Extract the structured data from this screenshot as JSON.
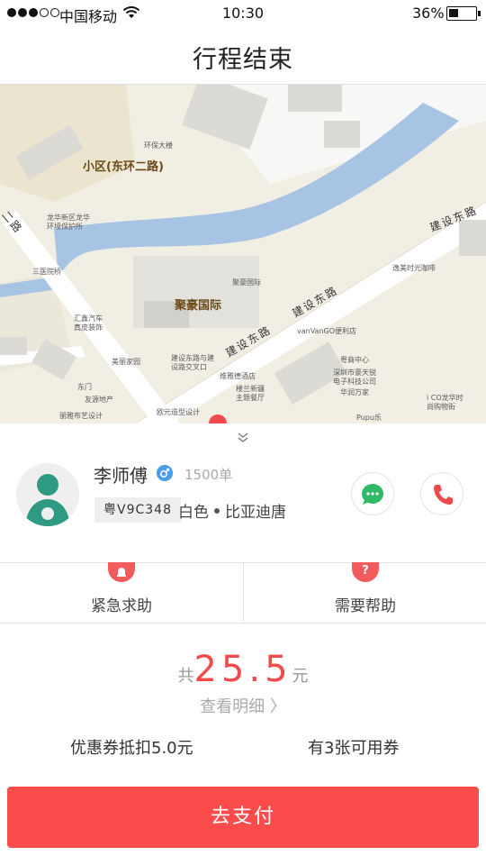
{
  "status_bar": {
    "carrier": "中国移动",
    "time": "10:30",
    "battery": "36%"
  },
  "nav": {
    "title": "行程结束"
  },
  "map": {
    "labels": {
      "district": "小区(东环二路)",
      "juhao": "聚豪国际",
      "road_jianshe_1": "建设东路",
      "road_jianshe_2": "建设东路",
      "road_jianshe_3": "建设东路",
      "road_side": "二路",
      "huanbao": "环保大楼",
      "longhua_env": "龙华新区龙华",
      "longhua_env2": "环境保护所",
      "sanyi": "三医院桥",
      "juhao_small": "聚豪国际",
      "yixian": "逸美时光咖啡",
      "vanvango": "vanVanGO便利店",
      "huiji": "汇鑫汽车",
      "huiji2": "真皮装饰",
      "meili": "美丽家园",
      "jianshe_cross": "建设东路与建",
      "jianshe_cross2": "设路交叉口",
      "yueshang": "粤商中心",
      "weiya": "维雅德酒店",
      "shenzhen_tech": "深圳市豪天锐",
      "shenzhen_tech2": "电子科技公司",
      "lan_xinjiang": "楼兰新疆",
      "lan_xinjiang2": "主题餐厅",
      "huarun": "华润万家",
      "ico": "i CO龙华时",
      "ico2": "尚购物街",
      "dongmen": "东门",
      "youyuan": "友源地产",
      "liya": "丽雅布艺设计",
      "oyuan": "欧元造型设计",
      "pupu": "Pupu乐"
    }
  },
  "driver": {
    "name": "李师傅",
    "gender_icon": "male-icon",
    "orders": "1500单",
    "plate": "粤V9C348",
    "color": "白色",
    "model": "比亚迪唐"
  },
  "help": {
    "emergency_label": "紧急求助",
    "emergency_icon": "alarm-icon",
    "need_help_label": "需要帮助",
    "need_help_icon": "?"
  },
  "fare": {
    "prefix": "共",
    "amount": "25.5",
    "unit": "元",
    "detail_link": "查看明细 〉"
  },
  "coupon": {
    "deduct": "优惠券抵扣5.0元",
    "available": "有3张可用券"
  },
  "pay_button": "去支付",
  "colors": {
    "accent": "#fb4c4c",
    "fare": "#f24a4a",
    "message": "#2fb865",
    "call": "#f04848",
    "gender": "#4a9de8",
    "avatar": "#2e9a82"
  }
}
